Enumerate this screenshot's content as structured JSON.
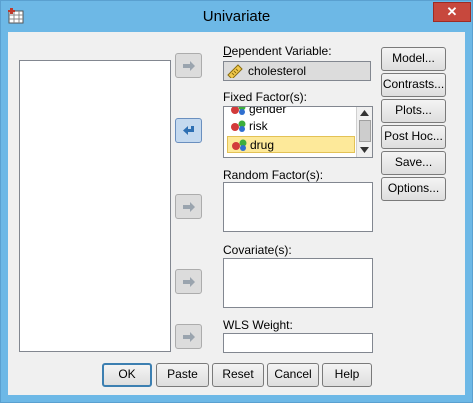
{
  "window": {
    "title": "Univariate",
    "close_glyph": "✕"
  },
  "dependent": {
    "label": "Dependent Variable:",
    "value": "cholesterol"
  },
  "fixed": {
    "label": "Fixed Factor(s):",
    "items": [
      "gender",
      "risk",
      "drug"
    ],
    "selected_index": 2
  },
  "random": {
    "label": "Random Factor(s):"
  },
  "covariate": {
    "label": "Covariate(s):"
  },
  "wls": {
    "label": "WLS Weight:"
  },
  "side_buttons": [
    "Model...",
    "Contrasts...",
    "Plots...",
    "Post Hoc...",
    "Save...",
    "Options..."
  ],
  "bottom_buttons": [
    "OK",
    "Paste",
    "Reset",
    "Cancel",
    "Help"
  ],
  "icons": {
    "app": "spss-app-icon",
    "arrow": "move-right-arrow-icon",
    "arrow_back": "move-left-arrow-icon",
    "scale": "ruler-scale-icon",
    "nominal": "nominal-balls-icon"
  },
  "colors": {
    "title_bar": "#6db8e6",
    "close": "#c7483d",
    "dialog": "#f0f0f0",
    "selected": "#fde99a",
    "dependent_bg": "#dcdcdc"
  }
}
